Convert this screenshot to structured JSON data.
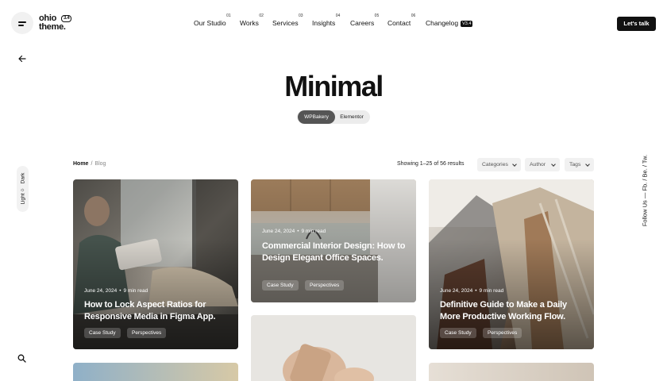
{
  "brand": {
    "logo_line1": "ohio",
    "logo_line2": "theme.",
    "version": "3.4"
  },
  "nav": [
    {
      "label": "Our Studio",
      "num": "01"
    },
    {
      "label": "Works",
      "num": "02"
    },
    {
      "label": "Services",
      "num": "03"
    },
    {
      "label": "Insights",
      "num": "04"
    },
    {
      "label": "Careers",
      "num": "05"
    },
    {
      "label": "Contact",
      "num": "06"
    },
    {
      "label": "Changelog",
      "badge": "V3.4"
    }
  ],
  "cta": {
    "label": "Let's talk"
  },
  "theme_toggle": {
    "light": "Light",
    "dark": "Dark"
  },
  "social": {
    "label": "Follow Us  —  Fb. / Be. / Tw."
  },
  "hero": {
    "title": "Minimal",
    "builders": [
      "WPBakery",
      "Elementor"
    ],
    "active_builder": "WPBakery"
  },
  "breadcrumb": {
    "home": "Home",
    "separator": "/",
    "current": "Blog"
  },
  "results": {
    "text": "Showing 1–25 of 56 results"
  },
  "filters": [
    "Categories",
    "Author",
    "Tags"
  ],
  "posts": [
    {
      "date": "June 24, 2024",
      "read_time": "9 min read",
      "title": "How to Lock Aspect Ratios for Responsive Media in Figma App.",
      "tags": [
        "Case Study",
        "Perspectives"
      ]
    },
    {
      "date": "June 24, 2024",
      "read_time": "9 min read",
      "title": "Commercial Interior Design: How to Design Elegant Office Spaces.",
      "tags": [
        "Case Study",
        "Perspectives"
      ]
    },
    {
      "date": "June 24, 2024",
      "read_time": "9 min read",
      "title": "Definitive Guide to Make a Daily More Productive Working Flow.",
      "tags": [
        "Case Study",
        "Perspectives"
      ]
    }
  ],
  "colors": {
    "accent": "#111111",
    "background": "#ffffff",
    "pill_active": "#555555"
  },
  "icons": {
    "menu": "hamburger-icon",
    "back": "arrow-left-icon",
    "search": "search-icon",
    "theme": "sun-icon"
  }
}
